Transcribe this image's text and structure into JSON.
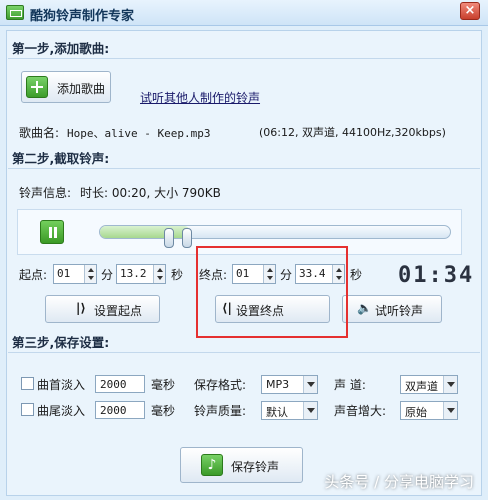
{
  "window": {
    "title": "酷狗铃声制作专家",
    "close_label": "×"
  },
  "step1": {
    "heading": "第一步,添加歌曲:",
    "add_song_label": "添加歌曲",
    "others_link": "试听其他人制作的铃声",
    "song_name_label": "歌曲名:",
    "song_name": "Hope、alive - Keep.mp3",
    "song_info": "(06:12, 双声道, 44100Hz,320kbps)"
  },
  "step2": {
    "heading": "第二步,截取铃声:",
    "ringtone_info_label": "铃声信息:",
    "duration_text": "时长: 00:20, 大小  790KB",
    "start_label": "起点:",
    "start_min": "01",
    "min_unit": "分",
    "start_sec": "13.2",
    "sec_unit": "秒",
    "end_label": "终点:",
    "end_min": "01",
    "end_sec": "33.4",
    "timer": "01:34",
    "set_start_label": "设置起点",
    "set_end_label": "设置终点",
    "preview_label": "试听铃声"
  },
  "step3": {
    "heading": "第三步,保存设置:",
    "fade_in_label": "曲首淡入",
    "fade_in_value": "2000",
    "fade_out_label": "曲尾淡入",
    "fade_out_value": "2000",
    "ms_unit": "毫秒",
    "format_label": "保存格式:",
    "format_value": "MP3",
    "channel_label": "声    道:",
    "channel_value": "双声道",
    "quality_label": "铃声质量:",
    "quality_value": "默认",
    "gain_label": "声音增大:",
    "gain_value": "原始",
    "save_label": "保存铃声"
  },
  "watermark": "头条号 / 分享电脑学习",
  "colors": {
    "highlight": "#e53030",
    "accent_green": "#3c9c2a"
  }
}
